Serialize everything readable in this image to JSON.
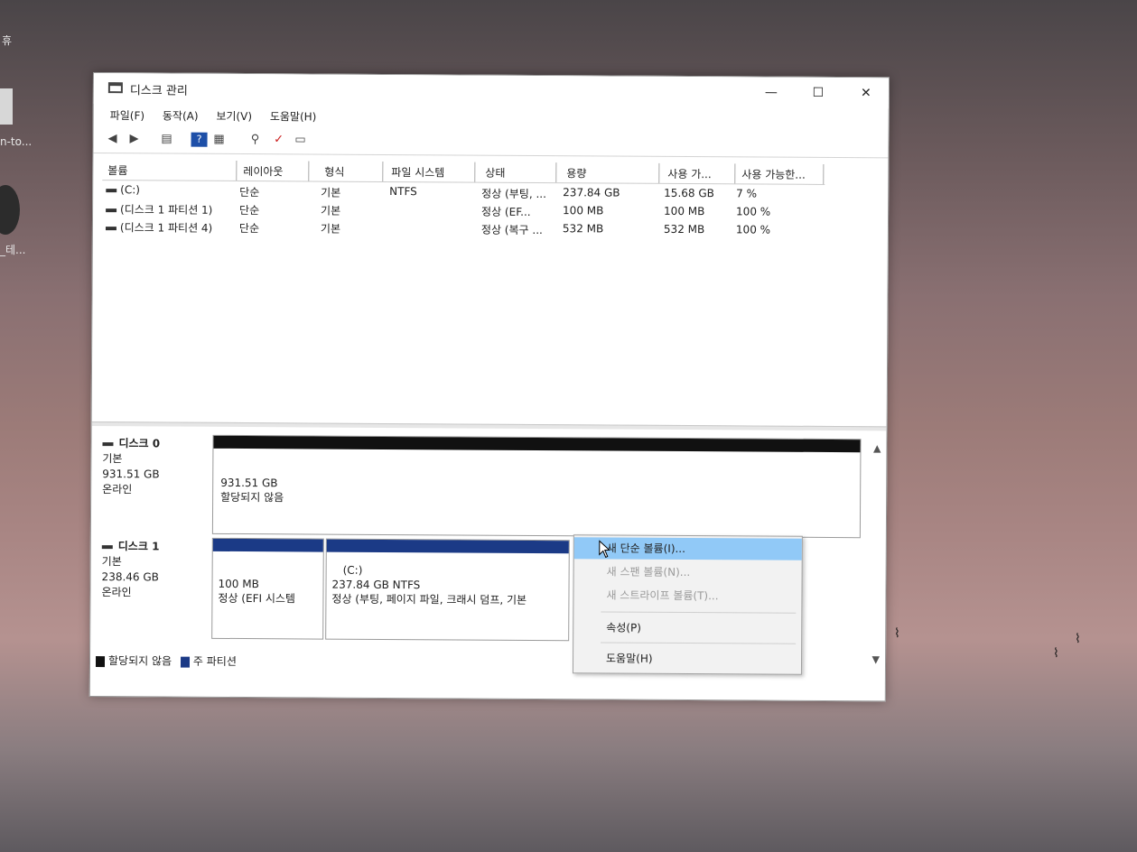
{
  "desktop": {
    "icons": [
      {
        "label": "휴"
      },
      {
        "label": "n-to..."
      },
      {
        "label": "_테..."
      }
    ]
  },
  "window": {
    "title": "디스크 관리",
    "controls": {
      "minimize": "—",
      "maximize": "☐",
      "close": "✕"
    }
  },
  "menu": [
    "파일(F)",
    "동작(A)",
    "보기(V)",
    "도움말(H)"
  ],
  "toolbar_icons": [
    "back-arrow-icon",
    "forward-arrow-icon",
    "list-icon",
    "help-icon",
    "grid-icon",
    "properties-icon",
    "check-icon",
    "window-icon"
  ],
  "volume_list": {
    "headers": [
      "볼륨",
      "레이아웃",
      "형식",
      "파일 시스템",
      "상태",
      "용량",
      "사용 가...",
      "사용 가능한..."
    ],
    "rows": [
      [
        "(C:)",
        "단순",
        "기본",
        "NTFS",
        "정상 (부팅, ...",
        "237.84 GB",
        "15.68 GB",
        "7 %"
      ],
      [
        "(디스크 1 파티션 1)",
        "단순",
        "기본",
        "",
        "정상 (EF...",
        "100 MB",
        "100 MB",
        "100 %"
      ],
      [
        "(디스크 1 파티션 4)",
        "단순",
        "기본",
        "",
        "정상 (복구 ...",
        "532 MB",
        "532 MB",
        "100 %"
      ]
    ]
  },
  "disks": [
    {
      "name": "디스크 0",
      "type": "기본",
      "size": "931.51 GB",
      "status": "온라인",
      "partitions": [
        {
          "size": "931.51 GB",
          "status": "할당되지 않음"
        }
      ]
    },
    {
      "name": "디스크 1",
      "type": "기본",
      "size": "238.46 GB",
      "status": "온라인",
      "partitions": [
        {
          "label": "",
          "size": "100 MB",
          "status": "정상 (EFI 시스템"
        },
        {
          "label": "(C:)",
          "size": "237.84 GB NTFS",
          "status": "정상 (부팅, 페이지 파일, 크래시 덤프, 기본"
        }
      ]
    }
  ],
  "legend": [
    {
      "label": "할당되지 않음",
      "color": "#111111"
    },
    {
      "label": "주 파티션",
      "color": "#1b3a86"
    }
  ],
  "context_menu": {
    "items": [
      {
        "label": "새 단순 볼륨(I)...",
        "state": "highlight"
      },
      {
        "label": "새 스팬 볼륨(N)...",
        "state": "disabled"
      },
      {
        "label": "새 스트라이프 볼륨(T)...",
        "state": "disabled"
      },
      {
        "label": "속성(P)",
        "state": "normal"
      },
      {
        "label": "도움말(H)",
        "state": "normal"
      }
    ]
  },
  "colors": {
    "unallocated": "#111111",
    "primary_partition": "#1b3a86",
    "menu_highlight": "#91c9f7"
  }
}
